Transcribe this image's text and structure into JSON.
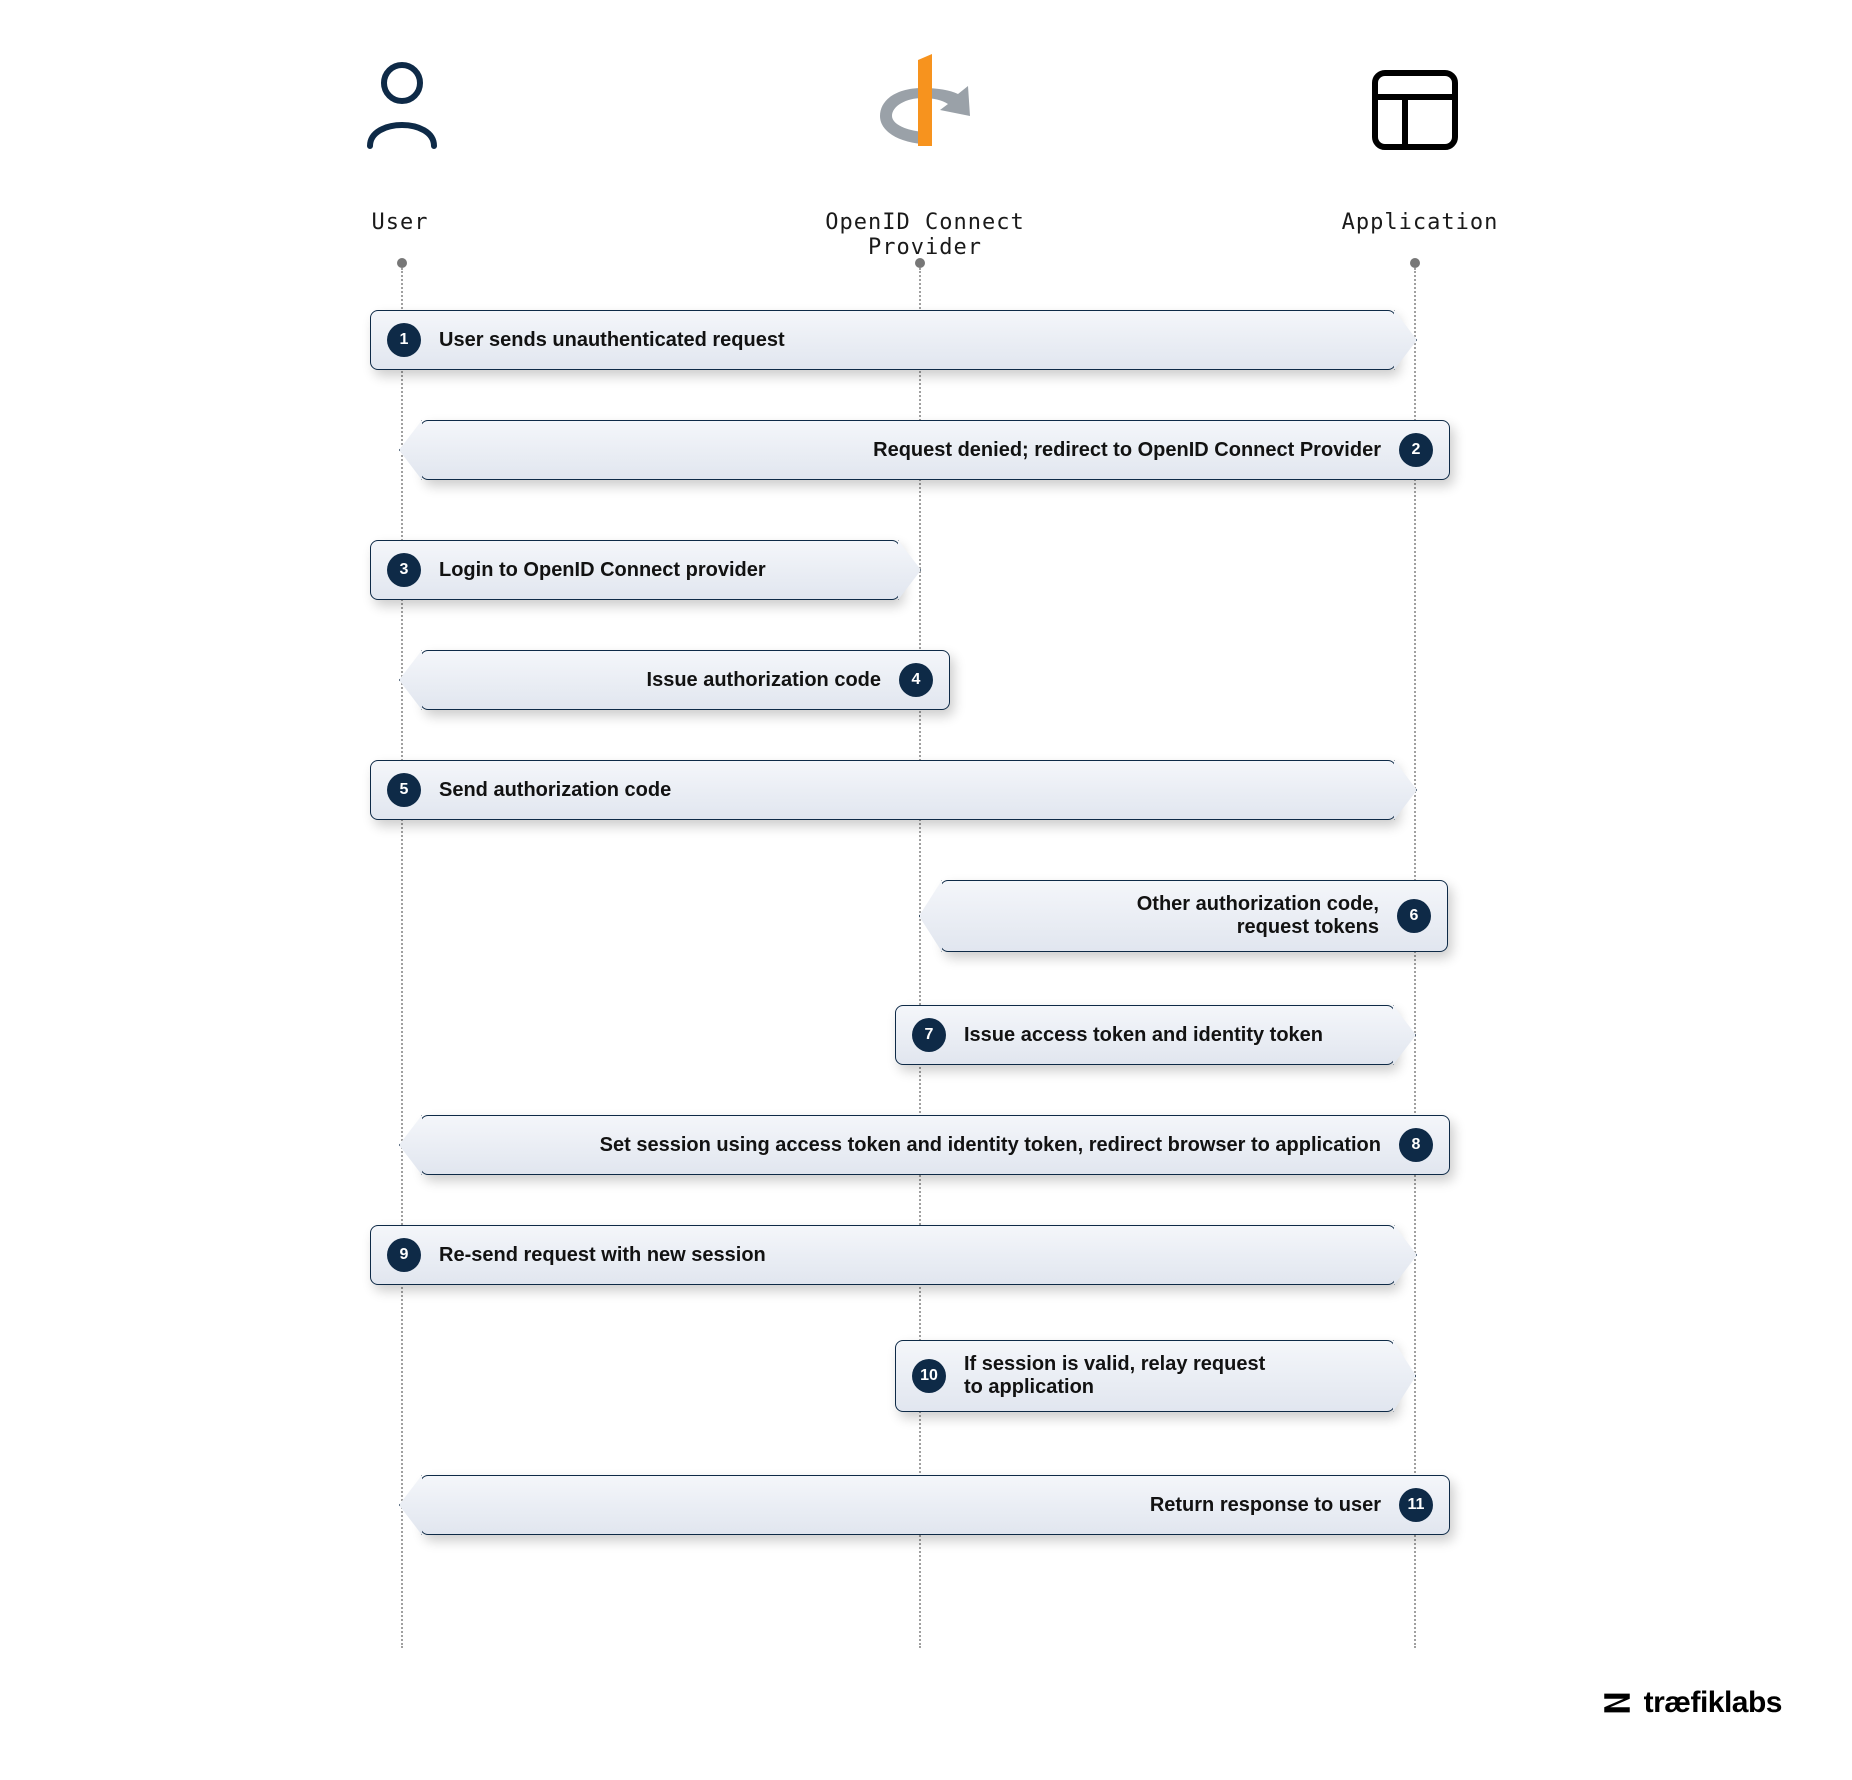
{
  "actors": {
    "user": "User",
    "provider": "OpenID Connect Provider",
    "application": "Application"
  },
  "steps": [
    {
      "n": "1",
      "text": "User sends unauthenticated request"
    },
    {
      "n": "2",
      "text": "Request denied; redirect to OpenID Connect Provider"
    },
    {
      "n": "3",
      "text": "Login to OpenID Connect provider"
    },
    {
      "n": "4",
      "text": "Issue authorization code"
    },
    {
      "n": "5",
      "text": "Send authorization code"
    },
    {
      "n": "6",
      "text": "Other authorization code,\nrequest tokens"
    },
    {
      "n": "7",
      "text": "Issue access token and identity token"
    },
    {
      "n": "8",
      "text": "Set session using access token and identity token, redirect browser to application"
    },
    {
      "n": "9",
      "text": "Re-send request with new session"
    },
    {
      "n": "10",
      "text": "If session is valid, relay request\nto application"
    },
    {
      "n": "11",
      "text": "Return response to user"
    }
  ],
  "branding": {
    "name": "træfiklabs"
  }
}
